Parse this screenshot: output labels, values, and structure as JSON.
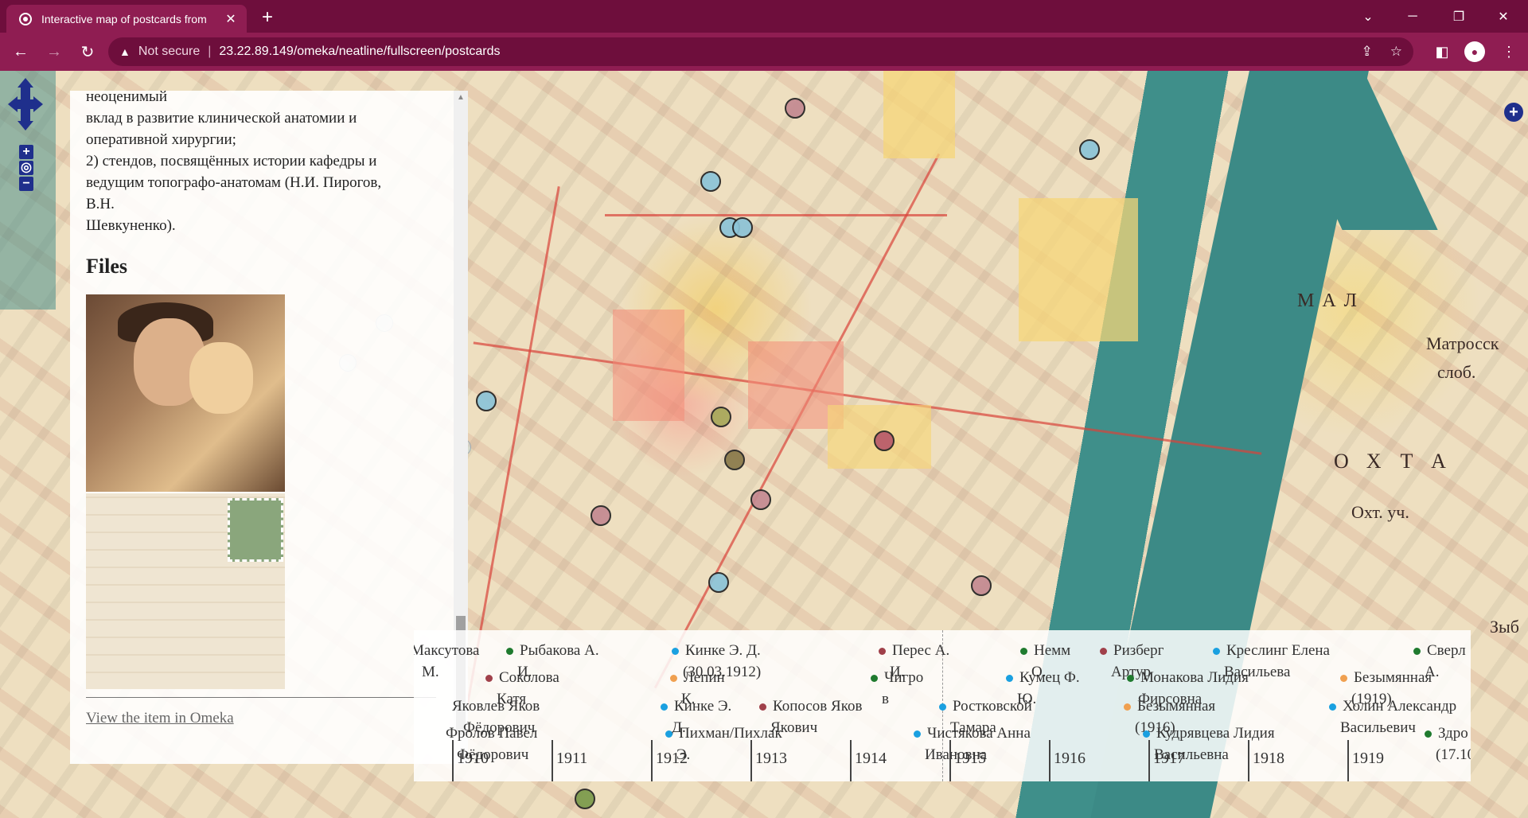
{
  "browser": {
    "tab_title": "Interactive map of postcards from",
    "tab_close": "✕",
    "new_tab": "+",
    "window": {
      "minimize": "─",
      "maximize": "❐",
      "close": "✕",
      "tabs_menu": "⌄"
    },
    "back": "←",
    "forward": "→",
    "reload": "↻",
    "security_icon": "▲",
    "security_label": "Not secure",
    "separator": "|",
    "url": "23.22.89.149/omeka/neatline/fullscreen/postcards",
    "share": "⇪",
    "star": "☆",
    "sidebar": "◧",
    "menu": "⋮",
    "profile": "●"
  },
  "map": {
    "labels": [
      {
        "text": "Матросск",
        "id": "l1"
      },
      {
        "text": "слоб.",
        "id": "l2"
      },
      {
        "text": "Охт. уч.",
        "id": "l3"
      },
      {
        "text": "ОХТА",
        "id": "l4"
      },
      {
        "text": "МАЛ",
        "id": "l5"
      },
      {
        "text": "Зыб",
        "id": "l6"
      }
    ],
    "controls": {
      "zoom_in": "+",
      "zoom_out": "−",
      "world": "◎",
      "expand": "+"
    }
  },
  "panel": {
    "text_lines": [
      "неоценимый",
      "вклад в развитие клинической анатомии и",
      "оперативной хирургии;",
      "2) стендов, посвящённых истории кафедры и",
      "ведущим топографо-анатомам (Н.И. Пирогов,",
      "В.Н.",
      "Шевкуненко)."
    ],
    "files_heading": "Files",
    "view_link": "View the item in Omeka"
  },
  "timeline": {
    "events": [
      {
        "text": "Максутова",
        "sub": "М.",
        "color": ""
      },
      {
        "text": "Рыбакова А.",
        "sub": "И.",
        "color": "#1f7a2e"
      },
      {
        "text": "Кинке Э. Д.",
        "sub": "(30.03.1912)",
        "color": "#1aa0e0"
      },
      {
        "text": "Перес А.",
        "sub": "И.",
        "color": "#a0404a"
      },
      {
        "text": "Немм",
        "sub": "О.",
        "color": "#1f7a2e"
      },
      {
        "text": "Ризберг",
        "sub": "Артур",
        "color": "#a0404a"
      },
      {
        "text": "Креслинг Елена",
        "sub": "Васильева",
        "color": "#1aa0e0"
      },
      {
        "text": "Сверл",
        "sub": "А.",
        "color": "#1f7a2e"
      },
      {
        "text": "Соколова",
        "sub": "Катя",
        "color": "#a0404a"
      },
      {
        "text": "Лепин",
        "sub": "К.",
        "color": "#f0a050"
      },
      {
        "text": "Чигро",
        "sub": "в",
        "color": "#1f7a2e"
      },
      {
        "text": "Кумец Ф.",
        "sub": "Ю.",
        "color": "#1aa0e0"
      },
      {
        "text": "Монакова Лидия",
        "sub": "Фирсовна",
        "color": "#1f7a2e"
      },
      {
        "text": "Безымянная",
        "sub": "(1919)",
        "color": "#f0a050"
      },
      {
        "text": "Яковлев Яков",
        "sub": "Фёдорович",
        "color": ""
      },
      {
        "text": "Кинке Э.",
        "sub": "Д.",
        "color": "#1aa0e0"
      },
      {
        "text": "Копосов Яков",
        "sub": "Якович",
        "color": "#a0404a"
      },
      {
        "text": "Ростковской",
        "sub": "Тамара",
        "color": "#1aa0e0"
      },
      {
        "text": "Безымянная",
        "sub": "(1916)",
        "color": "#f0a050"
      },
      {
        "text": "Холин Александр",
        "sub": "Васильевич",
        "color": "#1aa0e0"
      },
      {
        "text": "Фролов Павел",
        "sub": "Фёдорович",
        "color": ""
      },
      {
        "text": "Пихман/Пихлак",
        "sub": "Э.",
        "color": "#1aa0e0"
      },
      {
        "text": "Чистякова Анна",
        "sub": "Ивановна",
        "color": "#1aa0e0"
      },
      {
        "text": "Кудрявцева Лидия",
        "sub": "Васильевна",
        "color": "#1aa0e0"
      },
      {
        "text": "Здро",
        "sub": "(17.10",
        "color": "#1f7a2e"
      }
    ],
    "years": [
      "1910",
      "1911",
      "1912",
      "1913",
      "1914",
      "1915",
      "1916",
      "1917",
      "1918",
      "1919"
    ]
  }
}
